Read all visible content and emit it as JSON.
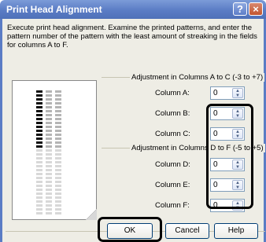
{
  "window": {
    "title": "Print Head Alignment",
    "help_icon": "question-mark",
    "close_icon": "close-x"
  },
  "instructions": "Execute print head alignment. Examine the printed patterns, and enter the pattern number of the pattern with the least amount of streaking in the fields for columns A to F.",
  "group_ac": {
    "label": "Adjustment in Columns A to C (-3 to +7)",
    "columns": [
      {
        "label": "Column A:",
        "value": "0"
      },
      {
        "label": "Column B:",
        "value": "0"
      },
      {
        "label": "Column C:",
        "value": "0"
      }
    ]
  },
  "group_df": {
    "label": "Adjustment in Columns D to F (-5 to +5)",
    "columns": [
      {
        "label": "Column D:",
        "value": "0"
      },
      {
        "label": "Column E:",
        "value": "0"
      },
      {
        "label": "Column F:",
        "value": "0"
      }
    ]
  },
  "buttons": {
    "ok": "OK",
    "cancel": "Cancel",
    "help": "Help"
  },
  "colors": {
    "titlebar": "#5a7cc5",
    "dialog_background": "#eeede5",
    "highlight": "#000000"
  }
}
